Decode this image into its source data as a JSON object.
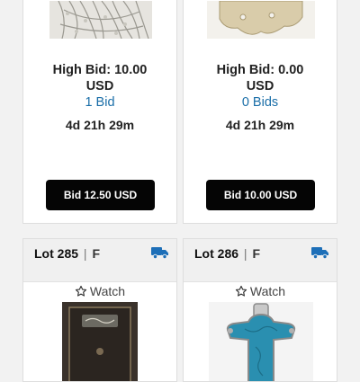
{
  "cards_top": [
    {
      "image_alt": "silver chain necklaces",
      "high_bid_line1": "High Bid: 10.00",
      "high_bid_line2": "USD",
      "bids": "1 Bid",
      "time_left": "4d 21h 29m",
      "bid_button": "Bid 12.50 USD"
    },
    {
      "image_alt": "carved bone pendant",
      "high_bid_line1": "High Bid: 0.00",
      "high_bid_line2": "USD",
      "bids": "0 Bids",
      "time_left": "4d 21h 29m",
      "bid_button": "Bid 10.00 USD"
    }
  ],
  "cards_bottom": [
    {
      "lot_label": "Lot 285",
      "separator": "|",
      "flag": "F",
      "shipping_icon": "truck-icon",
      "watch_label": "Watch",
      "image_alt": "boxed jewelry"
    },
    {
      "lot_label": "Lot 286",
      "separator": "|",
      "flag": "F",
      "shipping_icon": "truck-icon",
      "watch_label": "Watch",
      "image_alt": "turquoise cross pendant"
    }
  ],
  "colors": {
    "link_blue": "#1a6ea8",
    "truck_blue": "#1d6fb8",
    "button_black": "#050505",
    "turquoise": "#2a8fb0"
  }
}
